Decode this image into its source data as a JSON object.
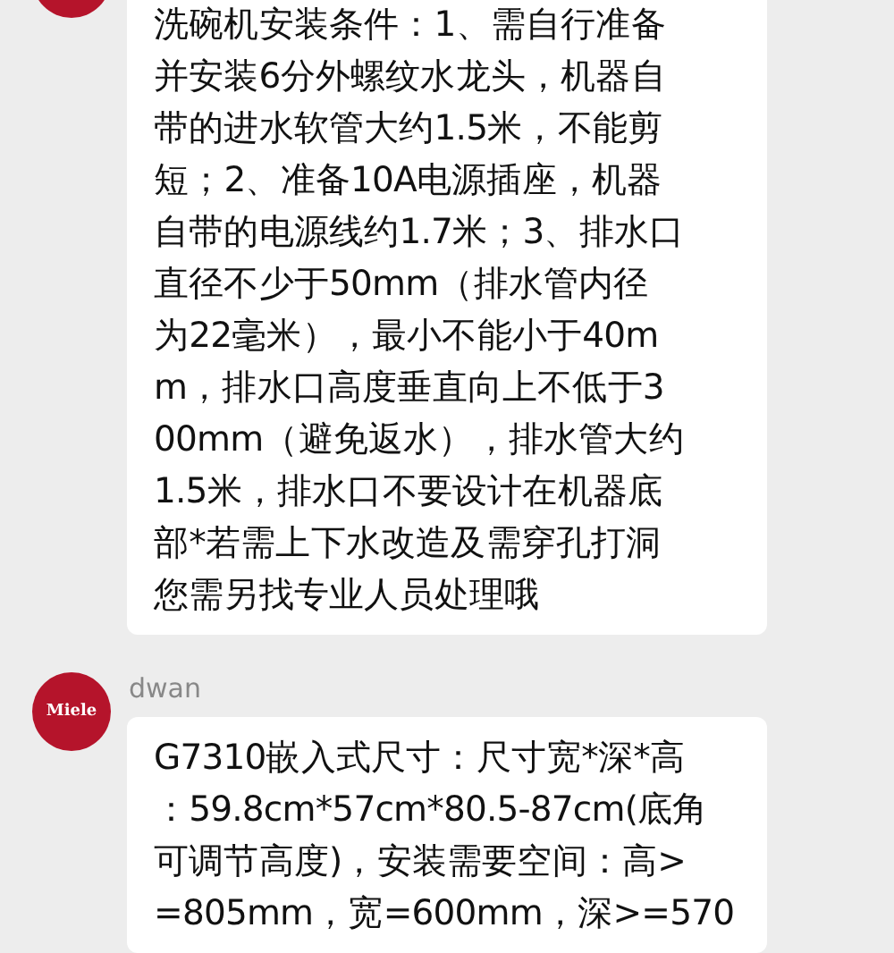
{
  "messages": [
    {
      "lines": [
        "洗碗机安装条件：1、需自行准备",
        "并安装6分外螺纹水龙头，机器自",
        "带的进水软管大约1.5米，不能剪",
        "短；2、准备10A电源插座，机器",
        "自带的电源线约1.7米；3、排水口",
        "直径不少于50mm（排水管内径",
        "为22毫米），最小不能小于40m",
        "m，排水口高度垂直向上不低于3",
        "00mm（避免返水），排水管大约",
        "1.5米，排水口不要设计在机器底",
        "部*若需上下水改造及需穿孔打洞",
        "您需另找专业人员处理哦"
      ]
    },
    {
      "sender": "dwan",
      "avatar_text": "Miele",
      "lines": [
        "G7310嵌入式尺寸：尺寸宽*深*高",
        "：59.8cm*57cm*80.5-87cm(底角",
        "可调节高度)，安装需要空间：高>",
        "=805mm，宽=600mm，深>=570"
      ]
    }
  ]
}
